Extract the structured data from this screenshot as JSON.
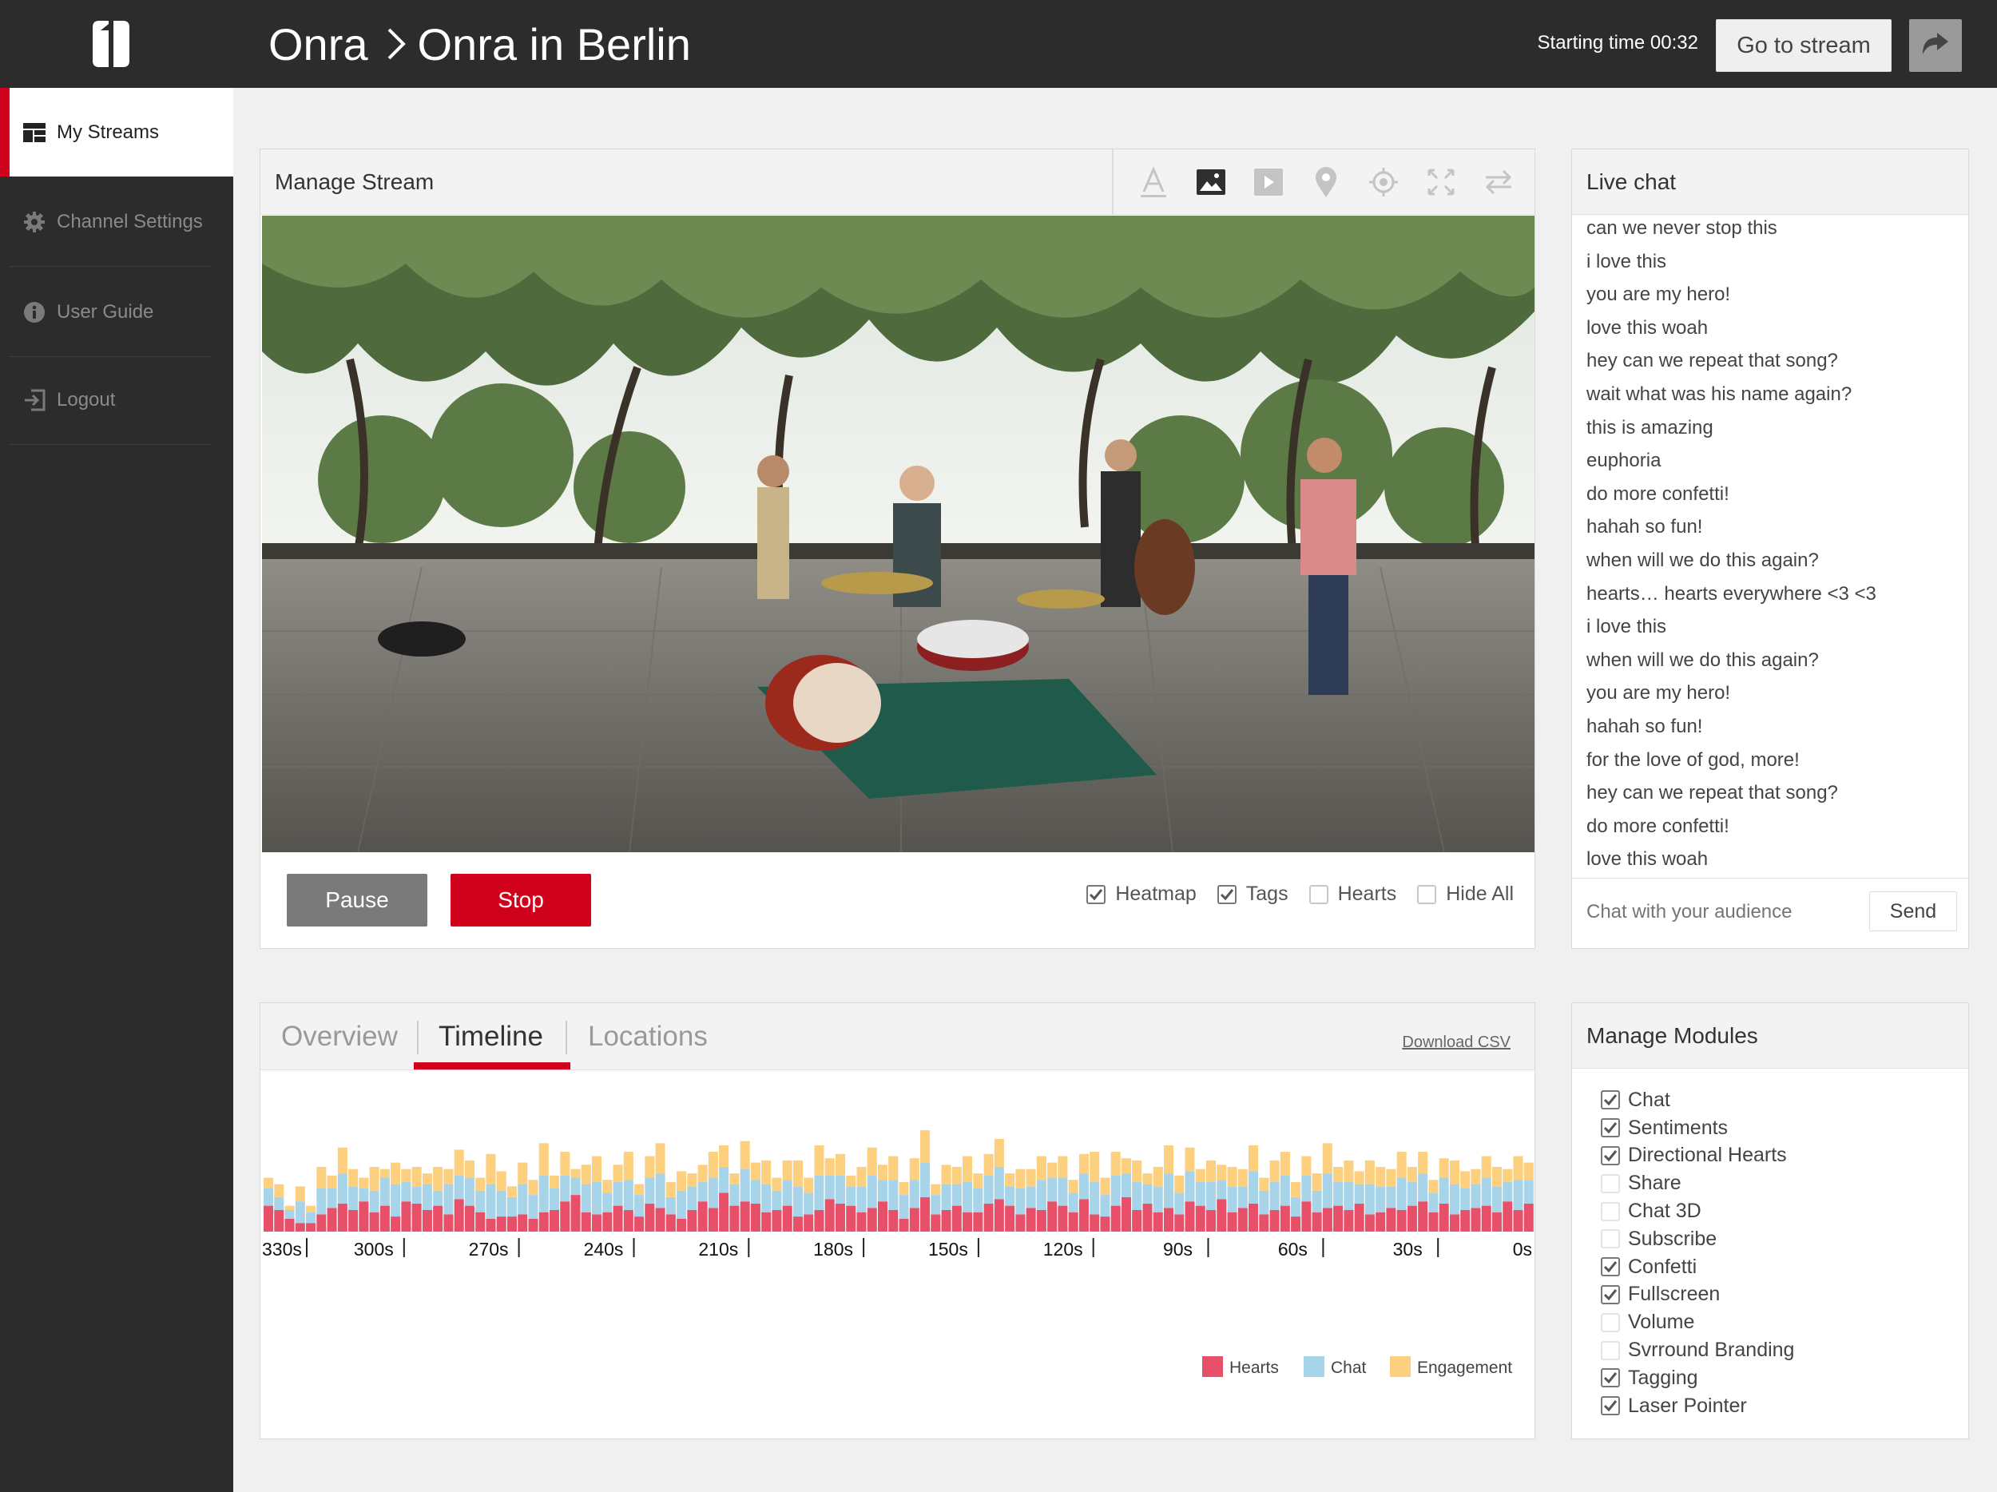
{
  "header": {
    "breadcrumb_root": "Onra",
    "breadcrumb_current": "Onra in Berlin",
    "starting_time": "Starting time 00:32",
    "go_to_stream": "Go to stream"
  },
  "sidebar": {
    "items": [
      {
        "label": "My Streams",
        "icon": "dashboard-icon",
        "active": true
      },
      {
        "label": "Channel Settings",
        "icon": "gear-icon",
        "active": false
      },
      {
        "label": "User Guide",
        "icon": "info-icon",
        "active": false
      },
      {
        "label": "Logout",
        "icon": "logout-icon",
        "active": false
      }
    ]
  },
  "stream": {
    "title": "Manage Stream",
    "tools": [
      "text-tool-icon",
      "image-tool-icon",
      "video-tool-icon",
      "location-pin-icon",
      "target-icon",
      "fullscreen-icon",
      "swap-icon"
    ],
    "pause_label": "Pause",
    "stop_label": "Stop",
    "options": [
      {
        "label": "Heatmap",
        "checked": true
      },
      {
        "label": "Tags",
        "checked": true
      },
      {
        "label": "Hearts",
        "checked": false
      },
      {
        "label": "Hide All",
        "checked": false
      }
    ]
  },
  "chat": {
    "title": "Live chat",
    "messages": [
      "can we never stop this",
      "i love this",
      "you are my hero!",
      "love this woah",
      "hey can we repeat that song?",
      "wait what was his name again?",
      "this is amazing",
      "euphoria",
      "do more confetti!",
      "hahah so fun!",
      "when will we do this again?",
      "hearts… hearts everywhere <3 <3",
      "i love this",
      "when will we do this again?",
      "you are my hero!",
      "hahah so fun!",
      "for the love of god, more!",
      "hey can we repeat that song?",
      "do more confetti!",
      "love this woah"
    ],
    "input_placeholder": "Chat with your audience",
    "send_label": "Send"
  },
  "analytics": {
    "tabs": [
      {
        "label": "Overview",
        "active": false
      },
      {
        "label": "Timeline",
        "active": true
      },
      {
        "label": "Locations",
        "active": false
      }
    ],
    "download_csv": "Download CSV"
  },
  "modules": {
    "title": "Manage Modules",
    "items": [
      {
        "label": "Chat",
        "checked": true
      },
      {
        "label": "Sentiments",
        "checked": true
      },
      {
        "label": "Directional Hearts",
        "checked": true
      },
      {
        "label": "Share",
        "checked": false
      },
      {
        "label": "Chat 3D",
        "checked": false
      },
      {
        "label": "Subscribe",
        "checked": false
      },
      {
        "label": "Confetti",
        "checked": true
      },
      {
        "label": "Fullscreen",
        "checked": true
      },
      {
        "label": "Volume",
        "checked": false
      },
      {
        "label": "Svrround Branding",
        "checked": false
      },
      {
        "label": "Tagging",
        "checked": true
      },
      {
        "label": "Laser Pointer",
        "checked": true
      }
    ]
  },
  "chart_data": {
    "type": "bar",
    "stacked": true,
    "x_tick_labels": [
      "330s",
      "300s",
      "270s",
      "240s",
      "210s",
      "180s",
      "150s",
      "120s",
      "90s",
      "60s",
      "30s",
      "0s"
    ],
    "xlim": [
      330,
      0
    ],
    "series": [
      {
        "name": "Hearts",
        "color": "#e8506a",
        "values": [
          12,
          10,
          6,
          4,
          4,
          8,
          11,
          13,
          10,
          14,
          9,
          12,
          7,
          14,
          13,
          10,
          12,
          8,
          15,
          12,
          9,
          6,
          7,
          7,
          8,
          6,
          9,
          10,
          14,
          17,
          9,
          8,
          9,
          12,
          10,
          7,
          13,
          11,
          8,
          6,
          10,
          14,
          11,
          18,
          12,
          14,
          13,
          9,
          10,
          12,
          7,
          8,
          10,
          15,
          13,
          12,
          9,
          11,
          14,
          10,
          6,
          11,
          16,
          8,
          10,
          12,
          9,
          9,
          13,
          15,
          12,
          8,
          11,
          10,
          14,
          12,
          9,
          15,
          8,
          7,
          12,
          16,
          10,
          13,
          9,
          11,
          8,
          14,
          12,
          10,
          15,
          9,
          11,
          13,
          8,
          10,
          12,
          7,
          14,
          9,
          11,
          12,
          10,
          13,
          8,
          9,
          11,
          10,
          12,
          14,
          9,
          13,
          8,
          10,
          11,
          12,
          9,
          14,
          10,
          13
        ]
      },
      {
        "name": "Chat",
        "color": "#a8d4ea",
        "values": [
          8,
          6,
          4,
          10,
          5,
          12,
          9,
          14,
          11,
          6,
          10,
          13,
          15,
          9,
          8,
          12,
          7,
          14,
          11,
          13,
          10,
          16,
          12,
          9,
          14,
          11,
          17,
          10,
          12,
          8,
          13,
          15,
          9,
          11,
          14,
          10,
          12,
          16,
          8,
          13,
          11,
          9,
          14,
          12,
          10,
          15,
          11,
          13,
          9,
          12,
          14,
          10,
          16,
          11,
          13,
          9,
          12,
          15,
          10,
          14,
          11,
          13,
          16,
          9,
          12,
          10,
          14,
          11,
          13,
          15,
          9,
          12,
          10,
          14,
          11,
          13,
          9,
          12,
          15,
          10,
          14,
          11,
          13,
          9,
          12,
          16,
          10,
          14,
          11,
          13,
          9,
          12,
          10,
          15,
          11,
          13,
          14,
          9,
          12,
          10,
          16,
          11,
          13,
          9,
          14,
          12,
          10,
          15,
          11,
          13,
          9,
          12,
          14,
          10,
          11,
          13,
          12,
          9,
          14,
          11
        ]
      },
      {
        "name": "Engagement",
        "color": "#fcd07e",
        "values": [
          5,
          6,
          2,
          7,
          3,
          10,
          6,
          12,
          8,
          5,
          11,
          4,
          10,
          6,
          9,
          5,
          11,
          7,
          12,
          8,
          6,
          14,
          9,
          5,
          10,
          7,
          15,
          6,
          11,
          4,
          9,
          12,
          6,
          8,
          13,
          5,
          10,
          14,
          7,
          9,
          6,
          8,
          12,
          10,
          5,
          13,
          8,
          11,
          6,
          9,
          12,
          7,
          14,
          8,
          10,
          5,
          9,
          13,
          7,
          11,
          6,
          10,
          15,
          5,
          9,
          8,
          12,
          7,
          10,
          13,
          6,
          9,
          8,
          11,
          7,
          10,
          6,
          9,
          14,
          8,
          11,
          7,
          10,
          5,
          9,
          13,
          8,
          11,
          6,
          10,
          7,
          9,
          8,
          12,
          6,
          10,
          11,
          7,
          9,
          8,
          14,
          7,
          10,
          6,
          11,
          9,
          8,
          12,
          7,
          10,
          6,
          9,
          11,
          8,
          7,
          10,
          9,
          6,
          11,
          8
        ]
      }
    ],
    "legend": [
      "Hearts",
      "Chat",
      "Engagement"
    ],
    "legend_position": "bottom-right"
  }
}
